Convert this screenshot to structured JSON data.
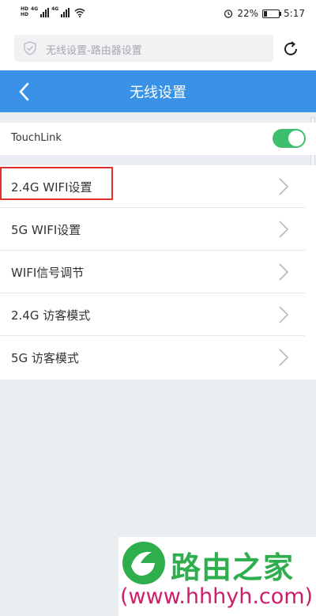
{
  "status_bar": {
    "hd1": "HD",
    "hd2": "HD",
    "gen1": "4G",
    "gen2": "4G",
    "battery_percent": "22%",
    "battery_level": 0.22,
    "time": "5:17"
  },
  "address_bar": {
    "text": "无线设置-路由器设置"
  },
  "header": {
    "title": "无线设置"
  },
  "touchlink": {
    "label": "TouchLink",
    "enabled": true
  },
  "list": {
    "items": [
      {
        "label": "2.4G WIFI设置"
      },
      {
        "label": "5G WIFI设置"
      },
      {
        "label": "WIFI信号调节"
      },
      {
        "label": "2.4G 访客模式"
      },
      {
        "label": "5G 访客模式"
      }
    ]
  },
  "watermark": {
    "text": "路由之家",
    "url": "(www.hhhyh.com)"
  },
  "colors": {
    "header": "#3a92e7",
    "toggle_on": "#3cc070",
    "highlight": "#e03030",
    "watermark_green": "#2fae4d",
    "watermark_pink": "#cc1f6a"
  }
}
